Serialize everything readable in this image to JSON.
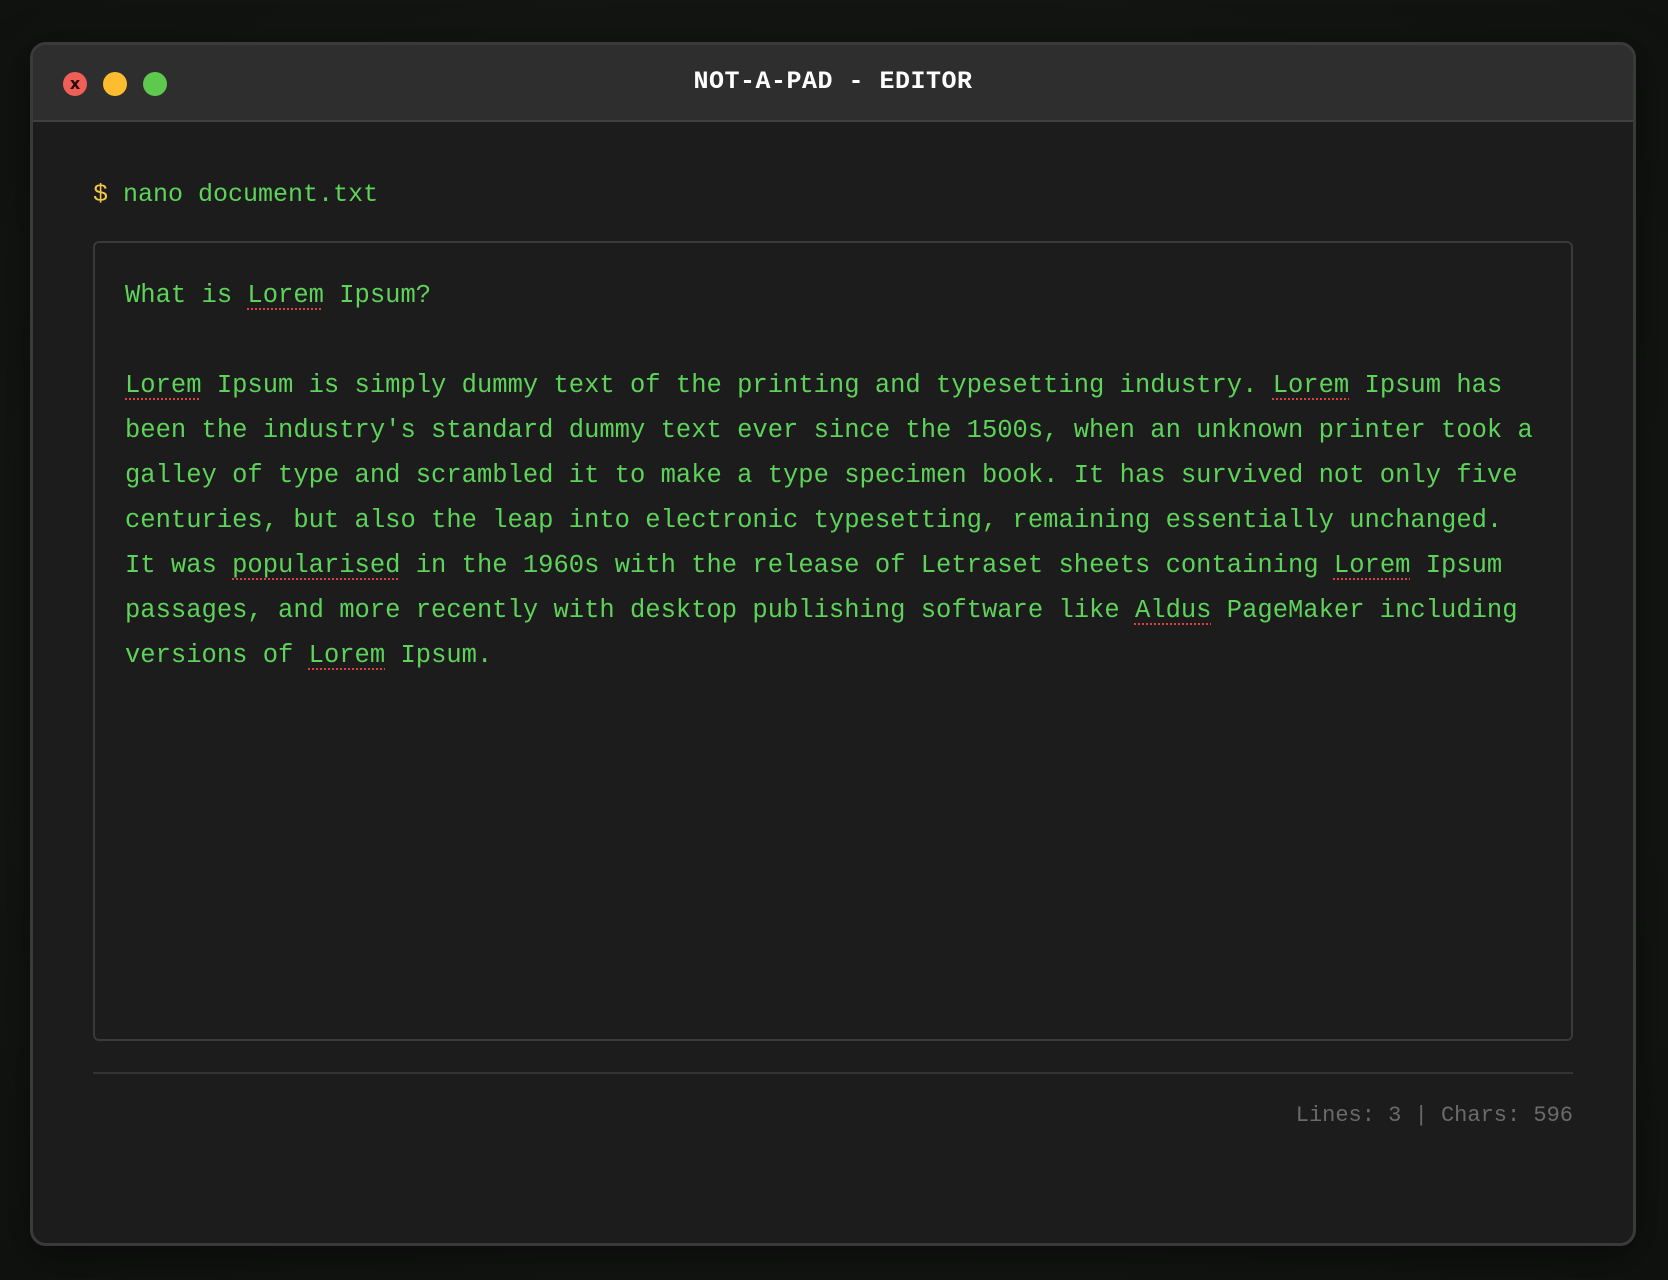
{
  "window": {
    "title": "NOT-A-PAD - EDITOR",
    "close_glyph": "x"
  },
  "prompt": {
    "symbol": "$",
    "command": "nano document.txt"
  },
  "editor": {
    "heading": {
      "part1": "What is ",
      "word1": "Lorem",
      "part2": " Ipsum?"
    },
    "body": {
      "w1": "Lorem",
      "t1": " Ipsum is simply dummy text of the printing and typesetting industry. ",
      "w2": "Lorem",
      "t2": " Ipsum has been the industry's standard dummy text ever since the 1500s, when an unknown printer took a galley of type and scrambled it to make a type specimen book. It has survived not only five centuries, but also the leap into electronic typesetting, remaining essentially unchanged. It was ",
      "w3": "popularised",
      "t3": " in the 1960s with the release of Letraset sheets containing ",
      "w4": "Lorem",
      "t4": " Ipsum passages, and more recently with desktop publishing software like ",
      "w5": "Aldus",
      "t5": " PageMaker including versions of ",
      "w6": "Lorem",
      "t6": " Ipsum."
    }
  },
  "status": {
    "text": "Lines: 3 | Chars: 596"
  },
  "colors": {
    "text_green": "#5ed35a",
    "prompt_yellow": "#f2c94c",
    "close_red": "#ef5f57",
    "minimize_yellow": "#febc2e",
    "maximize_green": "#5ec94e",
    "spellcheck_red": "#e04040"
  }
}
